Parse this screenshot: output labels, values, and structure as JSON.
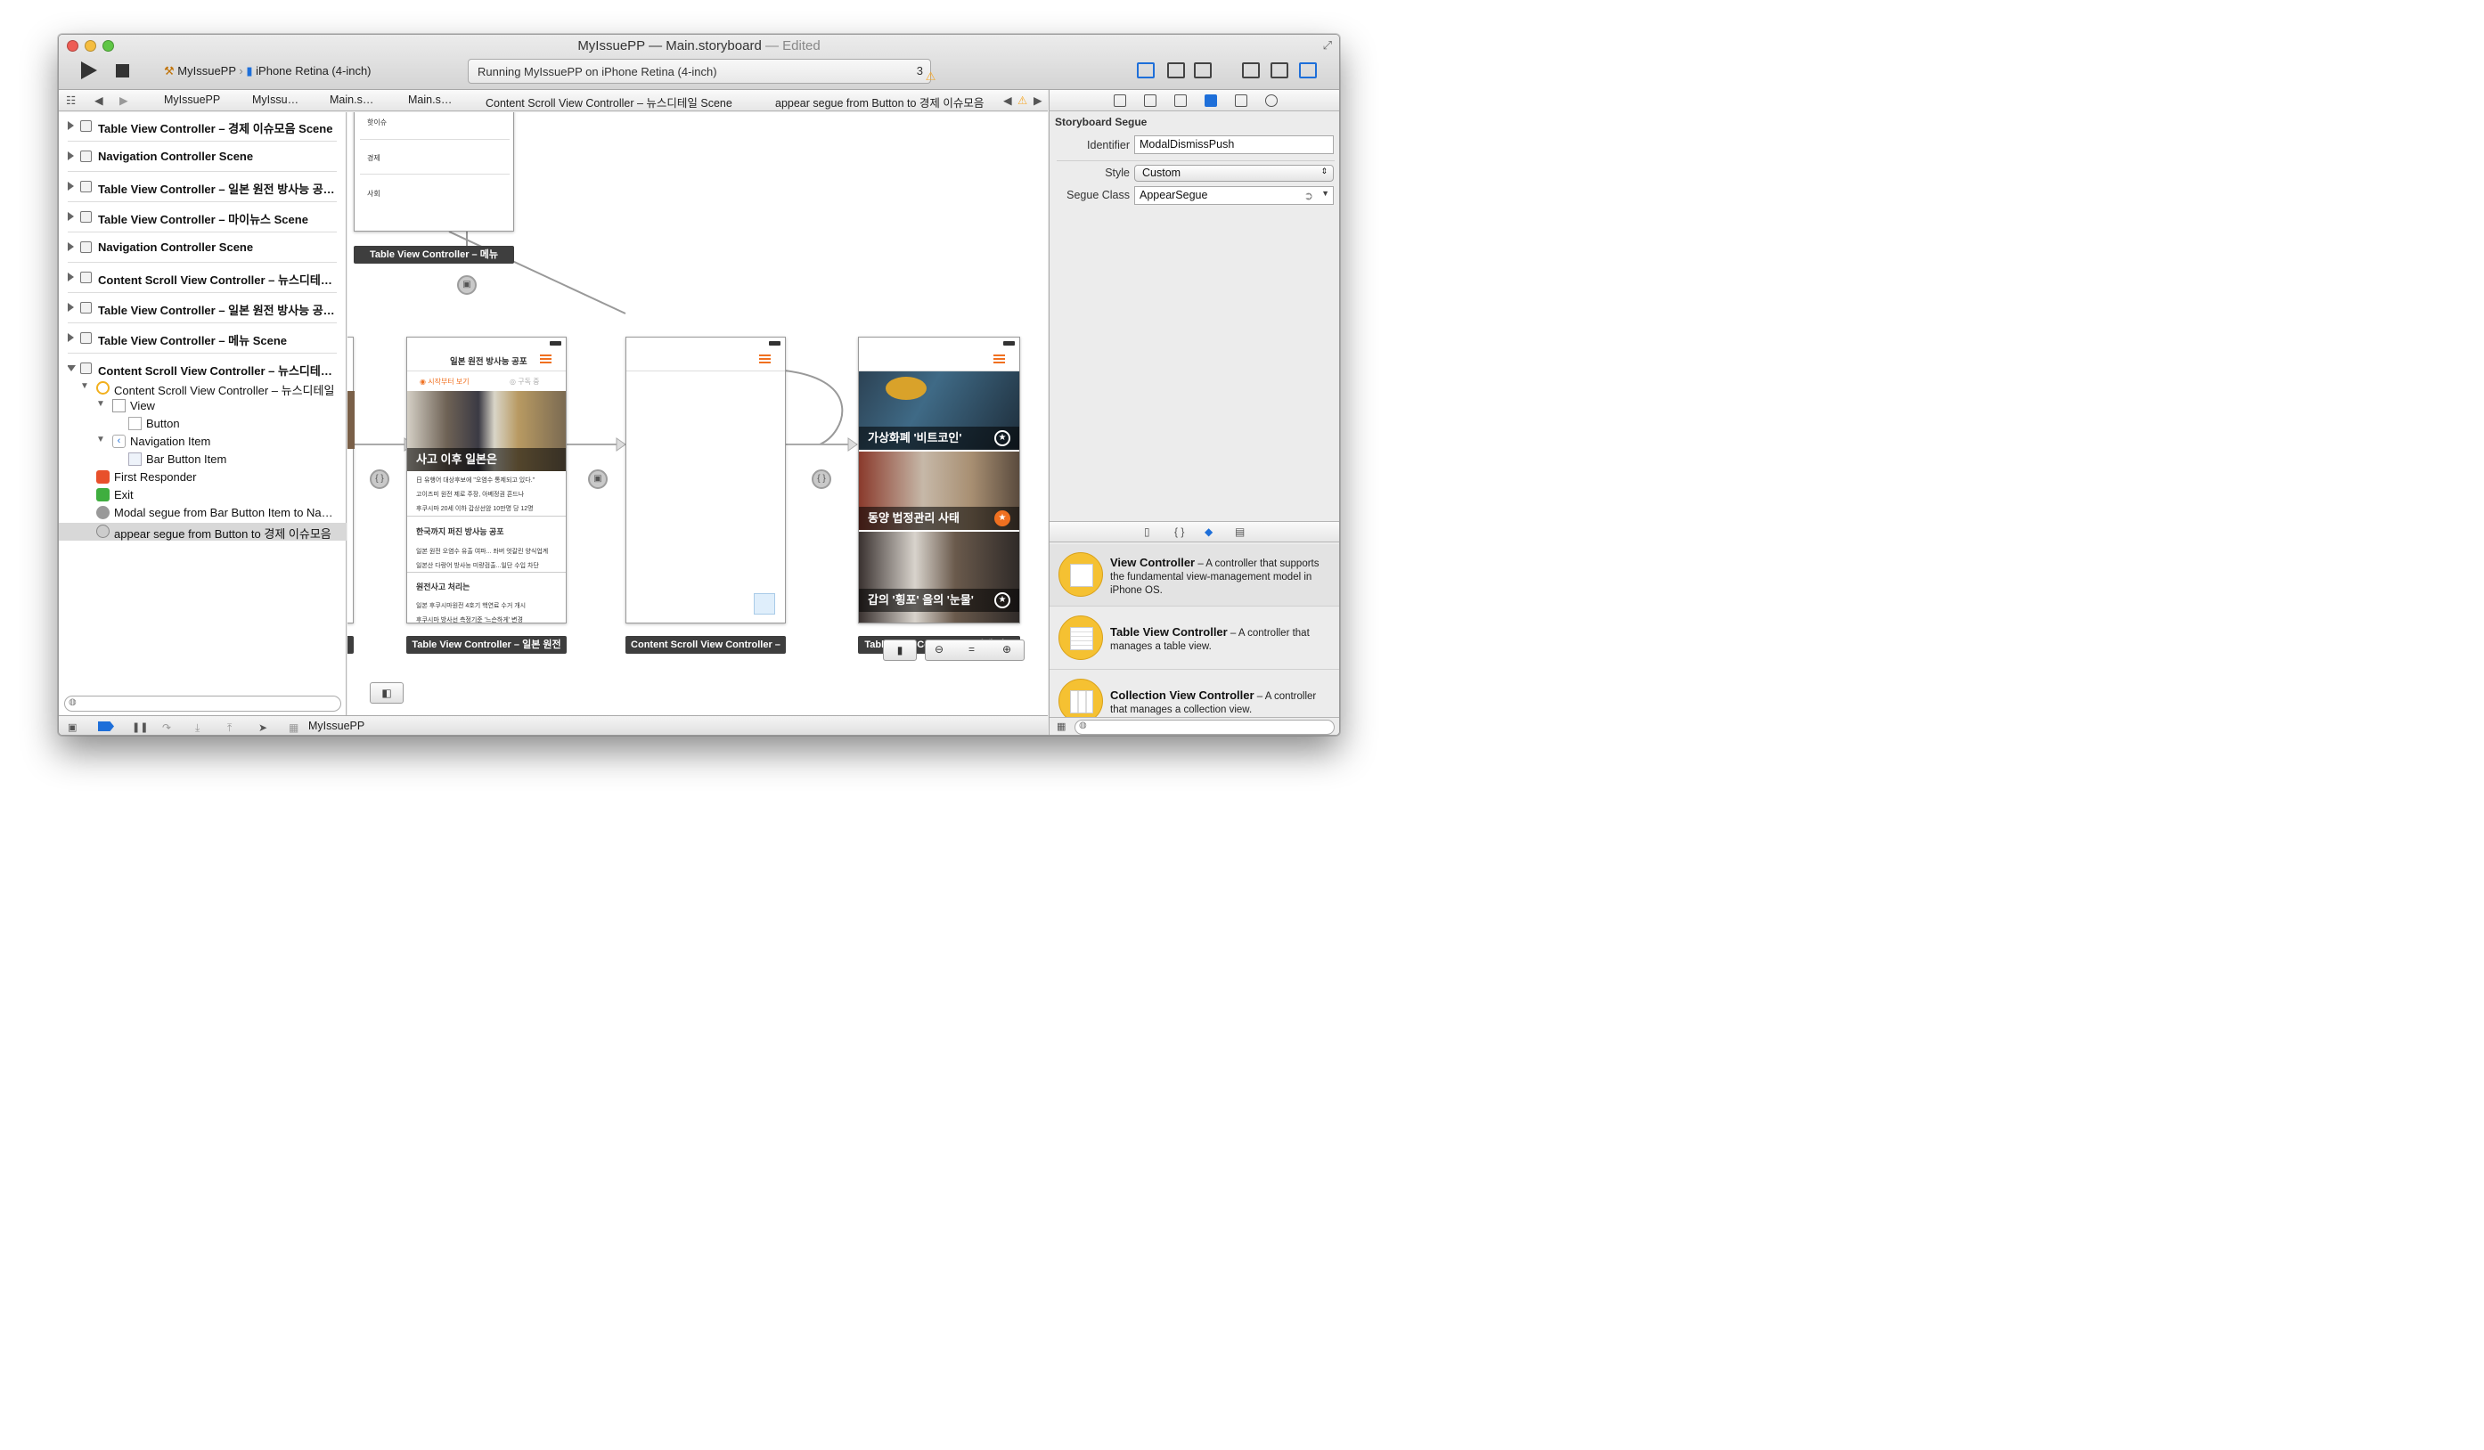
{
  "window": {
    "title_project": "MyIssuePP",
    "title_sep": "—",
    "title_file": "Main.storyboard",
    "title_state": "— Edited",
    "colors": {
      "accent": "#1e6fd9",
      "warning": "#f5a623",
      "orange": "#f07020",
      "library_icon": "#f5c132"
    }
  },
  "toolbar": {
    "scheme_target": "MyIssuePP",
    "scheme_device": "iPhone Retina (4-inch)",
    "activity_text": "Running MyIssuePP on iPhone Retina (4-inch)",
    "warning_count": "3"
  },
  "jumpbar": {
    "crumbs": [
      "MyIssuePP",
      "MyIssu…",
      "Main.s…",
      "Main.s…",
      "Content Scroll View Controller – 뉴스디테일 Scene",
      "appear segue from Button to 경제 이슈모음"
    ]
  },
  "outline": {
    "scenes": [
      "Table View Controller – 경제 이슈모음 Scene",
      "Navigation Controller Scene",
      "Table View Controller – 일본 원전 방사능 공…",
      "Table View Controller – 마이뉴스 Scene",
      "Navigation Controller Scene",
      "Content Scroll View Controller – 뉴스디테…",
      "Table View Controller – 일본 원전 방사능 공…",
      "Table View Controller – 메뉴 Scene",
      "Content Scroll View Controller – 뉴스디테…"
    ],
    "tree": {
      "controller": "Content Scroll View Controller – 뉴스디테일",
      "view": "View",
      "button": "Button",
      "nav_item": "Navigation Item",
      "bar_button": "Bar Button Item",
      "first_responder": "First Responder",
      "exit": "Exit",
      "modal_segue": "Modal segue from Bar Button Item to Na…",
      "appear_segue": "appear segue from Button to 경제 이슈모음"
    }
  },
  "canvas": {
    "menu_scene": {
      "rows": [
        "핫이슈",
        "경제",
        "사회"
      ],
      "label": "Table View Controller – 메뉴"
    },
    "japan_scene": {
      "nav_title": "일본 원전 방사능 공포",
      "tab_left": "시작부터 보기",
      "tab_right": "구독 중",
      "hero_caption": "사고 이후 일본은",
      "items_1": [
        "日 유행어 대상후보에 \"오염수 통제되고 있다.\"",
        "고이즈미 원전 제로 주장, 아베정권 흔드나",
        "후쿠시마 20세 이하 갑상선암 10만명 당 12명"
      ],
      "section_2": "한국까지 퍼진 방사능 공포",
      "items_2": [
        "일본 원전 오염수 유출 여파... 좌버 엇갈린 양식업계",
        "일본산 다랑어 방사능 미량검출...일단 수입 차단"
      ],
      "section_3": "원전사고 처리는",
      "items_3": [
        "일본 후쿠시마원전 4호기 핵연료 수거 개시",
        "후쿠시마 방사선 측정기준 '느슨하게' 변경"
      ],
      "label": "Table View Controller – 일본 원전"
    },
    "content_scene": {
      "label": "Content Scroll View Controller –"
    },
    "economy_scene": {
      "captions": [
        "가상화폐 '비트코인'",
        "동양 법정관리 사태",
        "갑의 '횡포' 을의 '눈물'"
      ],
      "label": "Table View Controller – 경제 이슈"
    }
  },
  "inspector": {
    "section_title": "Storyboard Segue",
    "identifier_label": "Identifier",
    "identifier_value": "ModalDismissPush",
    "style_label": "Style",
    "style_value": "Custom",
    "class_label": "Segue Class",
    "class_value": "AppearSegue"
  },
  "library": {
    "items": [
      {
        "title": "View Controller",
        "desc": " – A controller that supports the fundamental view-management model in iPhone OS."
      },
      {
        "title": "Table View Controller",
        "desc": " – A controller that manages a table view."
      },
      {
        "title": "Collection View Controller",
        "desc": " – A controller that manages a collection view."
      }
    ]
  },
  "debug": {
    "target": "MyIssuePP"
  }
}
